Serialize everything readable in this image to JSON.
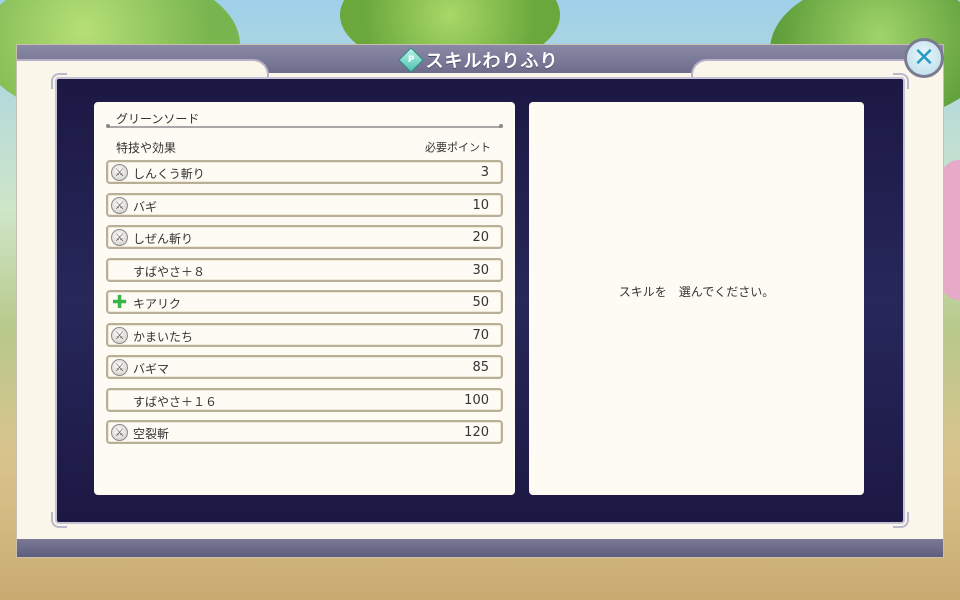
{
  "window": {
    "title": "スキルわりふり",
    "title_gem": "P"
  },
  "close_button": {
    "label": "✕"
  },
  "weapon": {
    "name": "グリーンソード",
    "header_left": "特技や効果",
    "header_right": "必要ポイント"
  },
  "skills": [
    {
      "name": "しんくう斬り",
      "cost": "3",
      "icon": "sword-icon"
    },
    {
      "name": "バギ",
      "cost": "10",
      "icon": "sword-icon"
    },
    {
      "name": "しぜん斬り",
      "cost": "20",
      "icon": "sword-icon"
    },
    {
      "name": "すばやさ＋８",
      "cost": "30",
      "icon": ""
    },
    {
      "name": "キアリク",
      "cost": "50",
      "icon": "heal-cross-icon"
    },
    {
      "name": "かまいたち",
      "cost": "70",
      "icon": "sword-icon"
    },
    {
      "name": "バギマ",
      "cost": "85",
      "icon": "sword-icon"
    },
    {
      "name": "すばやさ＋１６",
      "cost": "100",
      "icon": ""
    },
    {
      "name": "空裂斬",
      "cost": "120",
      "icon": "sword-icon"
    }
  ],
  "detail": {
    "prompt": "スキルを　選んでください。"
  },
  "colors": {
    "panel_dark": "#1c1844",
    "frame_bar": "#6d6c8b",
    "close_accent": "#2a9bc4",
    "heal_green": "#3bb54a"
  }
}
